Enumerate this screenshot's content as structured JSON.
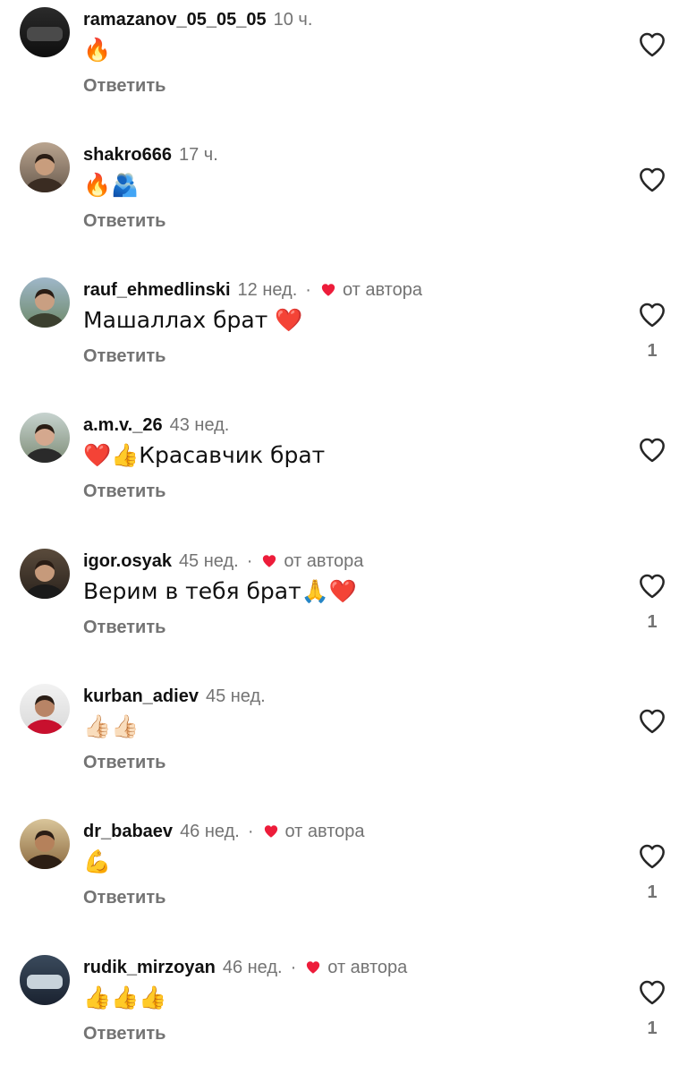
{
  "comments": [
    {
      "username": "ramazanov_05_05_05",
      "time": "10 ч.",
      "text": "🔥",
      "reply": "Ответить",
      "from_author": false,
      "author_label": "",
      "likes": "",
      "avatar": "car-photo"
    },
    {
      "username": "shakro666",
      "time": "17 ч.",
      "text": "🔥🫂",
      "reply": "Ответить",
      "from_author": false,
      "author_label": "",
      "likes": "",
      "avatar": "man-photo"
    },
    {
      "username": "rauf_ehmedlinski",
      "time": "12 нед.",
      "text": "Машаллах брат ❤️",
      "reply": "Ответить",
      "from_author": true,
      "author_label": "от автора",
      "likes": "1",
      "avatar": "man-sunglasses-photo"
    },
    {
      "username": "a.m.v._26",
      "time": "43 нед.",
      "text": "❤️👍Красавчик брат",
      "reply": "Ответить",
      "from_author": false,
      "author_label": "",
      "likes": "",
      "avatar": "man-outdoor-photo"
    },
    {
      "username": "igor.osyak",
      "time": "45 нед.",
      "text": "Верим в тебя брат🙏❤️",
      "reply": "Ответить",
      "from_author": true,
      "author_label": "от автора",
      "likes": "1",
      "avatar": "man-suit-photo"
    },
    {
      "username": "kurban_adiev",
      "time": "45 нед.",
      "text": "👍🏻👍🏻",
      "reply": "Ответить",
      "from_author": false,
      "author_label": "",
      "likes": "",
      "avatar": "wrestler-red-photo"
    },
    {
      "username": "dr_babaev",
      "time": "46 нед.",
      "text": "💪",
      "reply": "Ответить",
      "from_author": true,
      "author_label": "от автора",
      "likes": "1",
      "avatar": "man-curly-photo"
    },
    {
      "username": "rudik_mirzoyan",
      "time": "46 нед.",
      "text": "👍👍👍",
      "reply": "Ответить",
      "from_author": true,
      "author_label": "от автора",
      "likes": "1",
      "avatar": "sport-photo"
    }
  ],
  "colors": {
    "text_primary": "#111111",
    "text_secondary": "#737373",
    "author_heart": "#ed1c3a",
    "like_outline": "#262626",
    "background": "#ffffff"
  }
}
